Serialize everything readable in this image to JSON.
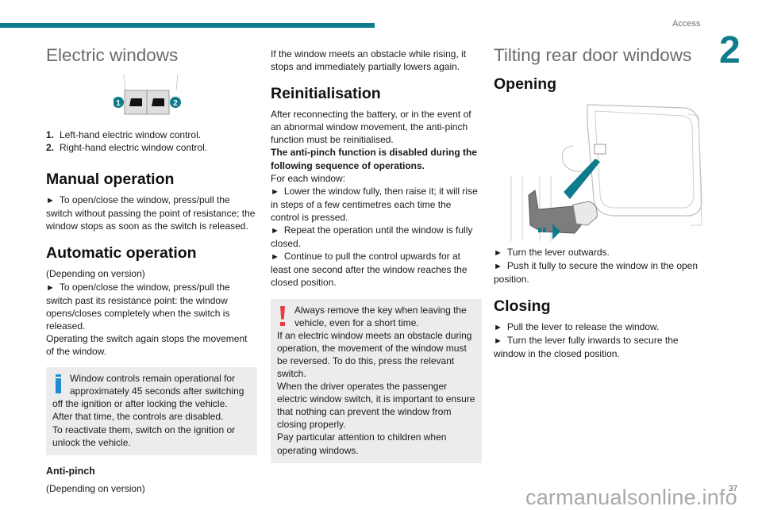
{
  "header": {
    "section": "Access",
    "chapter": "2",
    "accent_color": "#0e7c8c"
  },
  "col1": {
    "title": "Electric windows",
    "figure_callouts": [
      "1",
      "2"
    ],
    "list": [
      {
        "n": "1.",
        "text": "Left-hand electric window control."
      },
      {
        "n": "2.",
        "text": "Right-hand electric window control."
      }
    ],
    "manual": {
      "heading": "Manual operation",
      "step": "To open/close the window, press/pull the switch without passing the point of resistance; the window stops as soon as the switch is released."
    },
    "automatic": {
      "heading": "Automatic operation",
      "version": "(Depending on version)",
      "step": "To open/close the window, press/pull the switch past its resistance point: the window opens/closes completely when the switch is released.",
      "extra": "Operating the switch again stops the movement of the window."
    },
    "info_note": {
      "icon": "info-icon",
      "lines": [
        "Window controls remain operational for approximately 45 seconds after switching off the ignition or after locking the vehicle.",
        "After that time, the controls are disabled.",
        "To reactivate them, switch on the ignition or unlock the vehicle."
      ]
    },
    "antipinch": {
      "heading": "Anti-pinch",
      "version": "(Depending on version)"
    }
  },
  "col2": {
    "intro": "If the window meets an obstacle while rising, it stops and immediately partially lowers again.",
    "reinit": {
      "heading": "Reinitialisation",
      "text": "After reconnecting the battery, or in the event of an abnormal window movement, the anti-pinch function must be reinitialised.",
      "bold": "The anti-pinch function is disabled during the following sequence of operations.",
      "for_each": "For each window:",
      "steps": [
        "Lower the window fully, then raise it; it will rise in steps of a few centimetres each time the control is pressed.",
        "Repeat the operation until the window is fully closed.",
        "Continue to pull the control upwards for at least one second after the window reaches the closed position."
      ]
    },
    "warning_note": {
      "icon": "warning-icon",
      "lines": [
        "Always remove the key when leaving the vehicle, even for a short time.",
        "If an electric window meets an obstacle during operation, the movement of the window must be reversed. To do this, press the relevant switch.",
        "When the driver operates the passenger electric window switch, it is important to ensure that nothing can prevent the window from closing properly.",
        "Pay particular attention to children when operating windows."
      ]
    }
  },
  "col3": {
    "title": "Tilting rear door windows",
    "opening": {
      "heading": "Opening",
      "steps": [
        "Turn the lever outwards.",
        "Push it fully to secure the window in the open position."
      ]
    },
    "closing": {
      "heading": "Closing",
      "steps": [
        "Pull the lever to release the window.",
        "Turn the lever fully inwards to secure the window in the closed position."
      ]
    }
  },
  "footer": {
    "page": "37",
    "watermark": "carmanualsonline.info"
  }
}
